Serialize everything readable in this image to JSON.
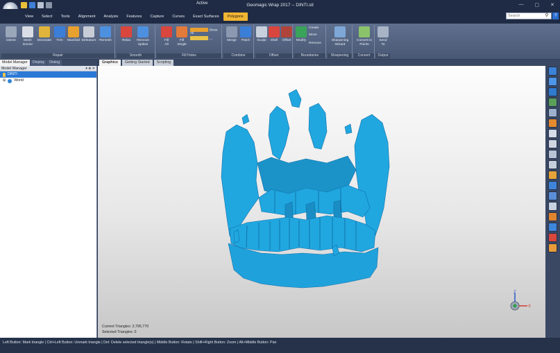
{
  "window": {
    "title": "Geomagic Wrap 2017 -- DINTI.stl",
    "context_label": "Active",
    "controls": [
      "—",
      "▢",
      "✕"
    ]
  },
  "menu": {
    "tabs": [
      "View",
      "Select",
      "Tools",
      "Alignment",
      "Analysis",
      "Features",
      "Capture",
      "Curves",
      "Exact Surfaces",
      "Polygons"
    ],
    "active_tab": "Polygons",
    "search_placeholder": "Search",
    "help_label": "?"
  },
  "ribbon": {
    "groups": [
      {
        "label": "Repair",
        "tools": [
          "Delete",
          "Mesh\nDoctor",
          "Decimate",
          "Trim",
          "Manifold",
          "Defeature",
          "Remesh"
        ]
      },
      {
        "label": "Smooth",
        "tools": [
          "Relax",
          "Remove\nSpikes"
        ]
      },
      {
        "label": "Fill Holes",
        "tools": [
          "Fill\nAll",
          "Fill\nSingle"
        ],
        "extra": "Show All"
      },
      {
        "label": "Combine",
        "tools": [
          "Merge",
          "Patch"
        ]
      },
      {
        "label": "Offset",
        "tools": [
          "Sculpt",
          "Shell",
          "Offset"
        ]
      },
      {
        "label": "Boundaries",
        "tools": [
          "Modify"
        ],
        "extra_items": [
          "Create",
          "Move",
          "Remove"
        ]
      },
      {
        "label": "Sharpening",
        "tools": [
          "Sharpening\nWizard"
        ]
      },
      {
        "label": "Convert",
        "tools": [
          "Convert to\nPoints"
        ]
      },
      {
        "label": "Output",
        "tools": [
          "Send\nTo"
        ]
      }
    ]
  },
  "left_panel": {
    "tabs": [
      "Model Manager",
      "Display",
      "Dialog"
    ],
    "active_tab": "Model Manager",
    "header": "Model Manager",
    "header_controls": "▾ ⊕ ✕",
    "tree": [
      {
        "label": "DINTI",
        "selected": true
      },
      {
        "label": "World",
        "selected": false
      }
    ]
  },
  "viewport": {
    "tabs": [
      "Graphics",
      "Getting Started",
      "Scripting"
    ],
    "active_tab": "Graphics",
    "stats": {
      "current_triangles": "Current Triangles: 2,795,770",
      "selected_triangles": "Selected Triangles: 0"
    },
    "axis_labels": {
      "z": "Z",
      "x": "X"
    },
    "model_color": "#21a7e0"
  },
  "status_bar": {
    "text": "Left Button: Mark triangle | Ctrl+Left Button: Unmark triangle | Del: Delete selected triangle(s) | Middle Button: Rotate | Shift+Right Button: Zoom | Alt+Middle Button: Pan"
  },
  "colors": {
    "title_bg": "#1f2b44",
    "ribbon_bg": "#566684",
    "active_tab": "#f0b532",
    "selection": "#2a79d6"
  }
}
